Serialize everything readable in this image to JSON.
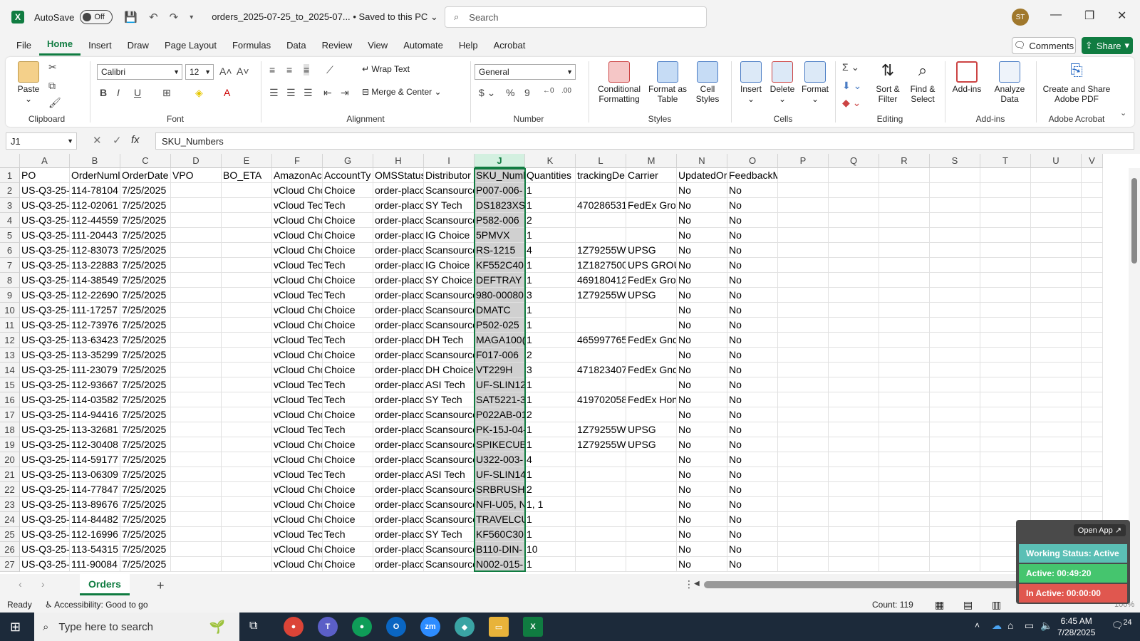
{
  "titlebar": {
    "autosave_label": "AutoSave",
    "autosave_state": "Off",
    "document_title": "orders_2025-07-25_to_2025-07...",
    "save_status": "• Saved to this PC",
    "search_placeholder": "Search",
    "user_initials": "ST"
  },
  "menu": [
    "File",
    "Home",
    "Insert",
    "Draw",
    "Page Layout",
    "Formulas",
    "Data",
    "Review",
    "View",
    "Automate",
    "Help",
    "Acrobat"
  ],
  "menu_active": "Home",
  "buttons": {
    "comments": "Comments",
    "share": "Share"
  },
  "ribbon": {
    "clipboard": {
      "paste": "Paste",
      "label": "Clipboard"
    },
    "font": {
      "name": "Calibri",
      "size": "12",
      "label": "Font"
    },
    "alignment": {
      "wrap_text": "Wrap Text",
      "merge_center": "Merge & Center",
      "label": "Alignment"
    },
    "number": {
      "format": "General",
      "label": "Number"
    },
    "styles": {
      "conditional": "Conditional\nFormatting",
      "format_table": "Format as\nTable",
      "cell_styles": "Cell\nStyles",
      "label": "Styles"
    },
    "cells": {
      "insert": "Insert",
      "delete": "Delete",
      "format": "Format",
      "label": "Cells"
    },
    "editing": {
      "sort_filter": "Sort &\nFilter",
      "find_select": "Find &\nSelect",
      "label": "Editing"
    },
    "addins": {
      "addins": "Add-ins",
      "analyze": "Analyze\nData",
      "label": "Add-ins"
    },
    "acrobat": {
      "create_share": "Create and Share\nAdobe PDF",
      "label": "Adobe Acrobat"
    }
  },
  "formula_bar": {
    "name_box": "J1",
    "formula": "SKU_Numbers"
  },
  "grid": {
    "columns": [
      "A",
      "B",
      "C",
      "D",
      "E",
      "F",
      "G",
      "H",
      "I",
      "J",
      "K",
      "L",
      "M",
      "N",
      "O",
      "P",
      "Q",
      "R",
      "S",
      "T",
      "U",
      "V"
    ],
    "selected_column": "J",
    "header_row": [
      "PO",
      "OrderNuml",
      "OrderDate",
      "VPO",
      "BO_ETA",
      "AmazonAc",
      "AccountTy",
      "OMSStatus",
      "Distributor",
      "SKU_Numb",
      "Quantities",
      "trackingDe",
      "Carrier",
      "UpdatedOr",
      "FeedbackMessage",
      "",
      "",
      "",
      "",
      "",
      "",
      ""
    ],
    "rows": [
      [
        "US-Q3-25-(",
        "114-78104",
        "7/25/2025",
        "",
        "",
        "vCloud Chc",
        "Choice",
        "order-placo",
        "Scansource",
        "P007-006-",
        "1",
        "",
        "",
        "No",
        "No"
      ],
      [
        "US-Q3-25-.",
        "112-02061",
        "7/25/2025",
        "",
        "",
        "vCloud Tec",
        "Tech",
        "order-placo",
        "SY Tech",
        "DS1823XS-",
        "1",
        "470286531",
        "FedEx Grou",
        "No",
        "No"
      ],
      [
        "US-Q3-25-(",
        "112-44559",
        "7/25/2025",
        "",
        "",
        "vCloud Chc",
        "Choice",
        "order-placo",
        "Scansource",
        "P582-006",
        "2",
        "",
        "",
        "No",
        "No"
      ],
      [
        "US-Q3-25-.",
        "111-20443",
        "7/25/2025",
        "",
        "",
        "vCloud Chc",
        "Choice",
        "order-placo",
        "IG Choice",
        "5PMVX",
        "1",
        "",
        "",
        "No",
        "No"
      ],
      [
        "US-Q3-25-(",
        "112-83073",
        "7/25/2025",
        "",
        "",
        "vCloud Chc",
        "Choice",
        "order-placo",
        "Scansource",
        "RS-1215",
        "4",
        "1Z79255W",
        "UPSG",
        "No",
        "No"
      ],
      [
        "US-Q3-25-.",
        "113-22883",
        "7/25/2025",
        "",
        "",
        "vCloud Tec",
        "Tech",
        "order-placo",
        "IG Choice",
        "KF552C40I",
        "1",
        "1Z1827500",
        "UPS GROU",
        "No",
        "No"
      ],
      [
        "US-Q3-25-(",
        "114-38549",
        "7/25/2025",
        "",
        "",
        "vCloud Chc",
        "Choice",
        "order-placo",
        "SY Choice",
        "DEFTRAY",
        "1",
        "469180412",
        "FedEx Grou",
        "No",
        "No"
      ],
      [
        "US-Q3-25-(",
        "112-22690",
        "7/25/2025",
        "",
        "",
        "vCloud Tec",
        "Tech",
        "order-placo",
        "Scansource",
        "980-00080",
        "3",
        "1Z79255W",
        "UPSG",
        "No",
        "No"
      ],
      [
        "US-Q3-25-(",
        "111-17257",
        "7/25/2025",
        "",
        "",
        "vCloud Chc",
        "Choice",
        "order-placo",
        "Scansource",
        "DMATC",
        "1",
        "",
        "",
        "No",
        "No"
      ],
      [
        "US-Q3-25-(",
        "112-73976",
        "7/25/2025",
        "",
        "",
        "vCloud Chc",
        "Choice",
        "order-placo",
        "Scansource",
        "P502-025",
        "1",
        "",
        "",
        "No",
        "No"
      ],
      [
        "US-Q3-25-.",
        "113-63423",
        "7/25/2025",
        "",
        "",
        "vCloud Tec",
        "Tech",
        "order-placo",
        "DH Tech",
        "MAGA100(",
        "1",
        "465997765",
        "FedEx Gnd",
        "No",
        "No"
      ],
      [
        "US-Q3-25-(",
        "113-35299",
        "7/25/2025",
        "",
        "",
        "vCloud Chc",
        "Choice",
        "order-placo",
        "Scansource",
        "F017-006",
        "2",
        "",
        "",
        "No",
        "No"
      ],
      [
        "US-Q3-25-(",
        "111-23079",
        "7/25/2025",
        "",
        "",
        "vCloud Chc",
        "Choice",
        "order-placo",
        "DH Choice",
        "VT229H",
        "3",
        "471823407",
        "FedEx Gnd",
        "No",
        "No"
      ],
      [
        "US-Q3-25-.",
        "112-93667",
        "7/25/2025",
        "",
        "",
        "vCloud Tec",
        "Tech",
        "order-placo",
        "ASI Tech",
        "UF-SLIN12(",
        "1",
        "",
        "",
        "No",
        "No"
      ],
      [
        "US-Q3-25-.",
        "114-03582",
        "7/25/2025",
        "",
        "",
        "vCloud Tec",
        "Tech",
        "order-placo",
        "SY Tech",
        "SAT5221-3",
        "1",
        "419702058",
        "FedEx Hon",
        "No",
        "No"
      ],
      [
        "US-Q3-25-(",
        "114-94416",
        "7/25/2025",
        "",
        "",
        "vCloud Chc",
        "Choice",
        "order-placo",
        "Scansource",
        "P022AB-01",
        "2",
        "",
        "",
        "No",
        "No"
      ],
      [
        "US-Q3-25-.",
        "113-32681",
        "7/25/2025",
        "",
        "",
        "vCloud Tec",
        "Tech",
        "order-placo",
        "Scansource",
        "PK-15J-04-",
        "1",
        "1Z79255W",
        "UPSG",
        "No",
        "No"
      ],
      [
        "US-Q3-25-(",
        "112-30408",
        "7/25/2025",
        "",
        "",
        "vCloud Chc",
        "Choice",
        "order-placo",
        "Scansource",
        "SPIKECUBE",
        "1",
        "1Z79255W",
        "UPSG",
        "No",
        "No"
      ],
      [
        "US-Q3-25-(",
        "114-59177",
        "7/25/2025",
        "",
        "",
        "vCloud Chc",
        "Choice",
        "order-placo",
        "Scansource",
        "U322-003-",
        "4",
        "",
        "",
        "No",
        "No"
      ],
      [
        "US-Q3-25-.",
        "113-06309",
        "7/25/2025",
        "",
        "",
        "vCloud Tec",
        "Tech",
        "order-placo",
        "ASI Tech",
        "UF-SLIN14(",
        "1",
        "",
        "",
        "No",
        "No"
      ],
      [
        "US-Q3-25-(",
        "114-77847",
        "7/25/2025",
        "",
        "",
        "vCloud Chc",
        "Choice",
        "order-placo",
        "Scansource",
        "SRBRUSHV",
        "2",
        "",
        "",
        "No",
        "No"
      ],
      [
        "US-Q3-25-(",
        "113-89676",
        "7/25/2025",
        "",
        "",
        "vCloud Chc",
        "Choice",
        "order-placo",
        "Scansource",
        "NFI-U05, N",
        "1, 1",
        "",
        "",
        "No",
        "No"
      ],
      [
        "US-Q3-25-(",
        "114-84482",
        "7/25/2025",
        "",
        "",
        "vCloud Chc",
        "Choice",
        "order-placo",
        "Scansource",
        "TRAVELCU",
        "1",
        "",
        "",
        "No",
        "No"
      ],
      [
        "US-Q3-25-.",
        "112-16996",
        "7/25/2025",
        "",
        "",
        "vCloud Tec",
        "Tech",
        "order-placo",
        "SY Tech",
        "KF560C30I",
        "1",
        "",
        "",
        "No",
        "No"
      ],
      [
        "US-Q3-25-(",
        "113-54315",
        "7/25/2025",
        "",
        "",
        "vCloud Chc",
        "Choice",
        "order-placo",
        "Scansource",
        "B110-DIN-",
        "10",
        "",
        "",
        "No",
        "No"
      ],
      [
        "US-Q3-25-.",
        "111-90084",
        "7/25/2025",
        "",
        "",
        "vCloud Chc",
        "Choice",
        "order-placo",
        "Scansource",
        "N002-015-",
        "1",
        "",
        "",
        "No",
        "No"
      ]
    ]
  },
  "sheet_tab": "Orders",
  "status": {
    "ready": "Ready",
    "accessibility": "Accessibility: Good to go",
    "count": "Count: 119",
    "zoom": "100%"
  },
  "widget": {
    "open_app": "Open App ↗",
    "working": "Working Status: Active",
    "active": "Active: 00:49:20",
    "inactive": "In Active: 00:00:00"
  },
  "taskbar": {
    "search_placeholder": "Type here to search",
    "time": "6:45 AM",
    "date": "7/28/2025",
    "notifications": "24"
  },
  "colors": {
    "excel_green": "#107c41",
    "selection_gray": "#d0d0d0",
    "widget_teal": "#5bbfb5",
    "widget_green": "#45c56e",
    "widget_red": "#e0574f"
  }
}
